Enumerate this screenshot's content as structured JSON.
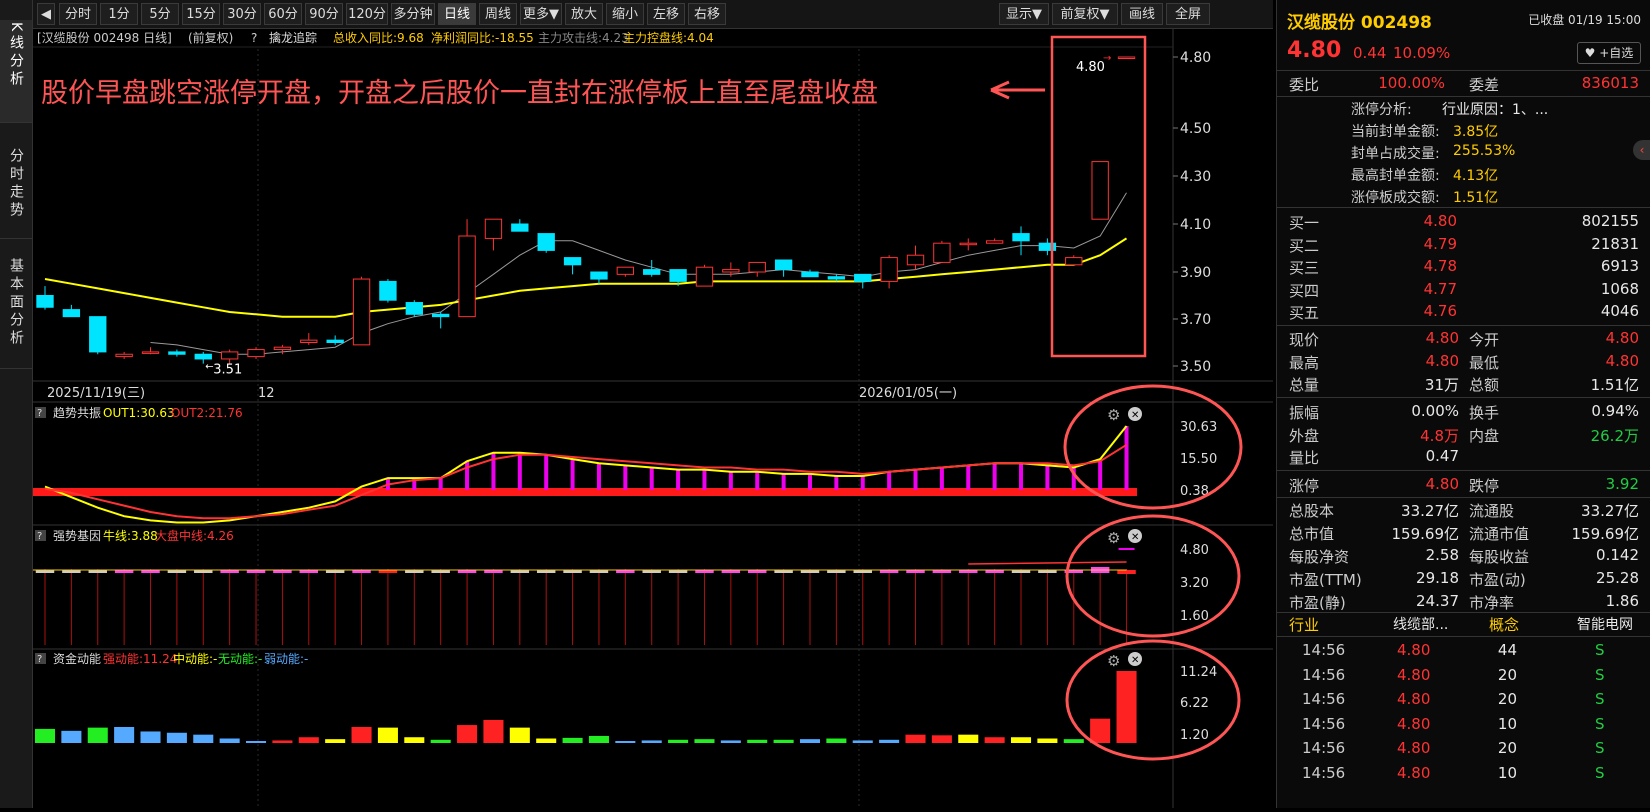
{
  "leftrail": {
    "tabs": [
      "K线分析",
      "分时走势",
      "基本面分析"
    ]
  },
  "toolbar": {
    "back_icon": "back-icon",
    "buttons": [
      "分时",
      "1分",
      "5分",
      "15分",
      "30分",
      "60分",
      "90分",
      "120分",
      "多分钟",
      "日线",
      "周线",
      "更多▼",
      "放大",
      "缩小",
      "左移",
      "右移"
    ],
    "active": "日线",
    "right_buttons": [
      "显示▼",
      "前复权▼",
      "画线",
      "全屏"
    ]
  },
  "main_header": {
    "title": "[汉缆股份 002498 日线]",
    "adj": "(前复权)",
    "help": "?",
    "indicator": "擒龙追踪",
    "rev": "总收入同比:9.68",
    "profit": "净利润同比:-18.55",
    "attack": "主力攻击线:4.23",
    "control": "主力控盘线:4.04"
  },
  "annotation": {
    "text": "股价早盘跳空涨停开盘，开盘之后股价一直封在涨停板上直至尾盘收盘"
  },
  "price_axis": [
    "4.80",
    "4.50",
    "4.30",
    "4.10",
    "3.90",
    "3.70",
    "3.50"
  ],
  "price_labels": {
    "high": "4.80",
    "low": "3.51"
  },
  "date_axis": [
    "2025/11/19(三)",
    "12",
    "2026/01/05(一)"
  ],
  "chart_data": [
    {
      "type": "candlestick",
      "title": "汉缆股份 002498 日线",
      "ylim": [
        3.45,
        4.85
      ],
      "ohlc": [
        [
          3.8,
          3.84,
          3.74,
          3.75
        ],
        [
          3.74,
          3.76,
          3.71,
          3.71
        ],
        [
          3.71,
          3.71,
          3.55,
          3.56
        ],
        [
          3.54,
          3.56,
          3.53,
          3.55
        ],
        [
          3.56,
          3.58,
          3.55,
          3.56
        ],
        [
          3.56,
          3.57,
          3.54,
          3.55
        ],
        [
          3.55,
          3.56,
          3.51,
          3.53
        ],
        [
          3.53,
          3.57,
          3.51,
          3.56
        ],
        [
          3.54,
          3.58,
          3.53,
          3.57
        ],
        [
          3.57,
          3.59,
          3.55,
          3.58
        ],
        [
          3.6,
          3.64,
          3.59,
          3.61
        ],
        [
          3.61,
          3.63,
          3.59,
          3.6
        ],
        [
          3.59,
          3.88,
          3.59,
          3.87
        ],
        [
          3.86,
          3.87,
          3.77,
          3.78
        ],
        [
          3.77,
          3.78,
          3.71,
          3.72
        ],
        [
          3.72,
          3.73,
          3.66,
          3.71
        ],
        [
          3.71,
          4.12,
          3.71,
          4.05
        ],
        [
          4.04,
          4.12,
          3.99,
          4.12
        ],
        [
          4.1,
          4.12,
          4.07,
          4.07
        ],
        [
          4.06,
          4.06,
          3.98,
          3.99
        ],
        [
          3.96,
          3.96,
          3.89,
          3.93
        ],
        [
          3.9,
          3.9,
          3.85,
          3.87
        ],
        [
          3.89,
          3.92,
          3.88,
          3.92
        ],
        [
          3.91,
          3.95,
          3.88,
          3.89
        ],
        [
          3.91,
          3.91,
          3.84,
          3.86
        ],
        [
          3.84,
          3.93,
          3.84,
          3.92
        ],
        [
          3.9,
          3.94,
          3.88,
          3.91
        ],
        [
          3.9,
          3.93,
          3.88,
          3.94
        ],
        [
          3.95,
          3.95,
          3.88,
          3.91
        ],
        [
          3.9,
          3.91,
          3.88,
          3.88
        ],
        [
          3.88,
          3.89,
          3.86,
          3.87
        ],
        [
          3.89,
          3.89,
          3.83,
          3.86
        ],
        [
          3.86,
          3.97,
          3.83,
          3.96
        ],
        [
          3.93,
          4.01,
          3.91,
          3.97
        ],
        [
          3.94,
          4.03,
          3.94,
          4.02
        ],
        [
          4.02,
          4.04,
          3.99,
          4.02
        ],
        [
          4.02,
          4.04,
          4.02,
          4.03
        ],
        [
          4.06,
          4.09,
          3.97,
          4.03
        ],
        [
          4.02,
          4.04,
          3.97,
          3.99
        ],
        [
          3.93,
          3.97,
          3.93,
          3.96
        ],
        [
          4.12,
          4.36,
          4.12,
          4.36
        ],
        [
          4.8,
          4.8,
          4.8,
          4.8
        ]
      ],
      "series": [
        {
          "name": "主力攻击线",
          "color": "#ff3333",
          "values": [
            null,
            null,
            null,
            null,
            3.6,
            3.59,
            3.57,
            3.55,
            3.55,
            3.56,
            3.57,
            3.58,
            3.64,
            3.68,
            3.71,
            3.73,
            3.81,
            3.89,
            3.97,
            4.03,
            4.03,
            3.99,
            3.95,
            3.92,
            3.89,
            3.89,
            3.89,
            3.9,
            3.91,
            3.9,
            3.89,
            3.88,
            3.9,
            3.91,
            3.94,
            3.97,
            3.99,
            4.01,
            4.01,
            4.0,
            4.05,
            4.23
          ]
        },
        {
          "name": "主力控盘线",
          "color": "#ffff00",
          "values": [
            3.87,
            3.85,
            3.83,
            3.81,
            3.79,
            3.77,
            3.75,
            3.73,
            3.72,
            3.71,
            3.71,
            3.71,
            3.73,
            3.74,
            3.75,
            3.76,
            3.78,
            3.8,
            3.82,
            3.83,
            3.84,
            3.85,
            3.85,
            3.85,
            3.85,
            3.86,
            3.86,
            3.86,
            3.86,
            3.86,
            3.86,
            3.86,
            3.87,
            3.88,
            3.89,
            3.9,
            3.91,
            3.92,
            3.93,
            3.93,
            3.97,
            4.04
          ]
        }
      ]
    },
    {
      "type": "line",
      "title": "趋势共振",
      "series": [
        {
          "name": "OUT1",
          "color": "#ffff00",
          "values": [
            2,
            -3,
            -8,
            -12,
            -14,
            -15,
            -15,
            -14,
            -12,
            -10,
            -8,
            -5,
            2,
            6,
            6,
            6,
            14,
            18,
            18,
            17,
            15,
            13,
            12,
            11,
            10,
            10,
            9,
            9,
            8,
            8,
            7,
            7,
            9,
            10,
            11,
            12,
            13,
            13,
            12,
            11,
            15,
            30.63
          ]
        },
        {
          "name": "OUT2",
          "color": "#ff3333",
          "values": [
            1,
            -1,
            -4,
            -7,
            -10,
            -12,
            -13,
            -13,
            -12,
            -11,
            -9,
            -7,
            -2,
            3,
            5,
            6,
            11,
            15,
            17,
            17,
            16,
            15,
            14,
            13,
            12,
            11,
            11,
            10,
            10,
            9,
            9,
            8,
            9,
            10,
            11,
            12,
            13,
            13,
            13,
            12,
            14,
            21.76
          ]
        }
      ],
      "bars": [
        0,
        0,
        0,
        0,
        0,
        0,
        0,
        0,
        0,
        0,
        0,
        0,
        0,
        6,
        6,
        6,
        14,
        18,
        18,
        17,
        15,
        13,
        12,
        11,
        10,
        10,
        9,
        9,
        8,
        8,
        7,
        7,
        9,
        10,
        11,
        12,
        13,
        13,
        12,
        11,
        15,
        30.63
      ],
      "axis": [
        "30.63",
        "15.50",
        "0.38"
      ]
    },
    {
      "type": "bar",
      "title": "强势基因",
      "labels": {
        "bull": "牛线:3.88",
        "market": "大盘中线:4.26"
      },
      "axis": [
        "4.80",
        "3.20",
        "1.60"
      ]
    },
    {
      "type": "bar",
      "title": "资金动能",
      "labels": {
        "strong": "强动能:11.24",
        "mid": "中动能:-",
        "none": "无动能:-",
        "weak": "弱动能:-"
      },
      "values": [
        2.2,
        1.9,
        2.4,
        2.5,
        1.8,
        1.6,
        1.3,
        0.7,
        0.3,
        0.4,
        0.9,
        0.6,
        2.5,
        2.4,
        0.9,
        0.5,
        2.8,
        3.6,
        2.4,
        0.7,
        0.8,
        1.1,
        0.3,
        0.4,
        0.5,
        0.6,
        0.4,
        0.5,
        0.5,
        0.6,
        0.7,
        0.4,
        0.5,
        1.3,
        1.2,
        1.3,
        0.9,
        0.9,
        0.7,
        0.6,
        3.8,
        11.24
      ],
      "colors": [
        "#22ee22",
        "#55aaff",
        "#22ee22",
        "#55aaff",
        "#55aaff",
        "#55aaff",
        "#55aaff",
        "#55aaff",
        "#55aaff",
        "#ff2222",
        "#ff2222",
        "#ffff00",
        "#ff2222",
        "#ffff00",
        "#ffff00",
        "#22ee22",
        "#ff2222",
        "#ff2222",
        "#ffff00",
        "#ffff00",
        "#22ee22",
        "#22ee22",
        "#55aaff",
        "#55aaff",
        "#22ee22",
        "#22ee22",
        "#55aaff",
        "#22ee22",
        "#22ee22",
        "#55aaff",
        "#22ee22",
        "#55aaff",
        "#55aaff",
        "#ff2222",
        "#ff2222",
        "#ffff00",
        "#ff2222",
        "#ffff00",
        "#ffff00",
        "#22ee22",
        "#ff2222",
        "#ff2222"
      ],
      "axis": [
        "11.24",
        "6.22",
        "1.20"
      ]
    }
  ],
  "ind1": {
    "help": "?",
    "name": "趋势共振",
    "o1": "OUT1:30.63",
    "o2": "OUT2:21.76"
  },
  "ind2": {
    "help": "?",
    "name": "强势基因",
    "bull": "牛线:3.88",
    "market": "大盘中线:4.26"
  },
  "ind3": {
    "help": "?",
    "name": "资金动能",
    "strong": "强动能:11.24",
    "mid": "中动能:-",
    "none": "无动能:-",
    "weak": "弱动能:-"
  },
  "quote": {
    "name": "汉缆股份 002498",
    "status": "已收盘 01/19 15:00",
    "price": "4.80",
    "chg": "0.44",
    "pct": "10.09%",
    "fav": "+自选",
    "wb_label": "委比",
    "wb": "100.00%",
    "wc_label": "委差",
    "wc": "836013",
    "limit_info": [
      [
        "涨停分析:",
        "行业原因：1、..."
      ],
      [
        "当前封单金额:",
        "3.85亿"
      ],
      [
        "封单占成交量:",
        "255.53%"
      ],
      [
        "最高封单金额:",
        "4.13亿"
      ],
      [
        "涨停板成交额:",
        "1.51亿"
      ]
    ],
    "bids": [
      [
        "买一",
        "4.80",
        "802155"
      ],
      [
        "买二",
        "4.79",
        "21831"
      ],
      [
        "买三",
        "4.78",
        "6913"
      ],
      [
        "买四",
        "4.77",
        "1068"
      ],
      [
        "买五",
        "4.76",
        "4046"
      ]
    ],
    "stats1": [
      [
        "现价",
        "4.80",
        "今开",
        "4.80"
      ],
      [
        "最高",
        "4.80",
        "最低",
        "4.80"
      ],
      [
        "总量",
        "31万",
        "总额",
        "1.51亿"
      ]
    ],
    "stats2": [
      [
        "振幅",
        "0.00%",
        "换手",
        "0.94%"
      ],
      [
        "外盘",
        "4.8万",
        "内盘",
        "26.2万"
      ],
      [
        "量比",
        "0.47",
        "",
        ""
      ]
    ],
    "limits": [
      "涨停",
      "4.80",
      "跌停",
      "3.92"
    ],
    "fund": [
      [
        "总股本",
        "33.27亿",
        "流通股",
        "33.27亿"
      ],
      [
        "总市值",
        "159.69亿",
        "流通市值",
        "159.69亿"
      ],
      [
        "每股净资",
        "2.58",
        "每股收益",
        "0.142"
      ],
      [
        "市盈(TTM)",
        "29.18",
        "市盈(动)",
        "25.28"
      ],
      [
        "市盈(静)",
        "24.37",
        "市净率",
        "1.86"
      ]
    ],
    "sector": [
      "行业",
      "线缆部...",
      "概念",
      "智能电网"
    ],
    "ticks": [
      [
        "14:56",
        "4.80",
        "44",
        "S"
      ],
      [
        "14:56",
        "4.80",
        "20",
        "S"
      ],
      [
        "14:56",
        "4.80",
        "20",
        "S"
      ],
      [
        "14:56",
        "4.80",
        "10",
        "S"
      ],
      [
        "14:56",
        "4.80",
        "20",
        "S"
      ],
      [
        "14:56",
        "4.80",
        "10",
        "S"
      ]
    ]
  }
}
